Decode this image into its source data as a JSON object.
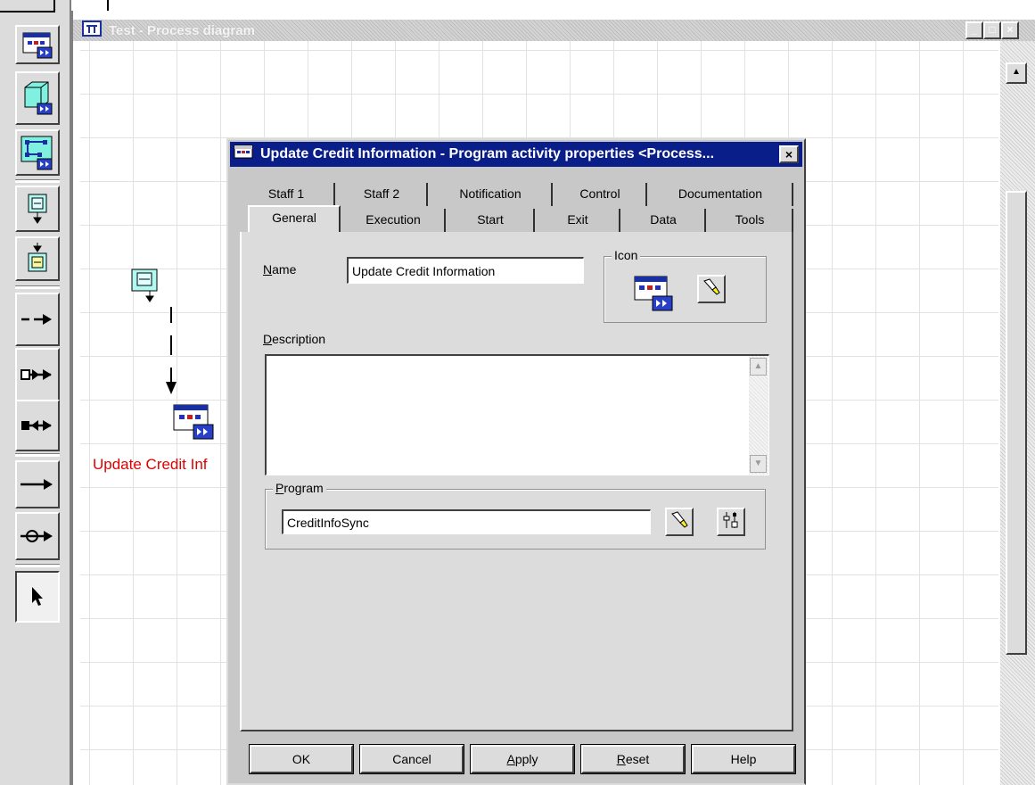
{
  "mdi_window": {
    "title": "Test - Process diagram",
    "minimize_glyph": "_",
    "restore_glyph": "□",
    "close_glyph": "×",
    "scroll_up_glyph": "▲"
  },
  "toolbar": {
    "tools": [
      {
        "icon": "program-activity-icon"
      },
      {
        "icon": "process-activity-icon"
      },
      {
        "icon": "block-activity-icon"
      },
      {
        "icon": "source-node-icon"
      },
      {
        "icon": "sink-node-icon"
      },
      {
        "icon": "control-connector-icon"
      },
      {
        "icon": "data-connector-icon"
      },
      {
        "icon": "data-connector-reverse-icon"
      },
      {
        "icon": "default-connector-icon"
      },
      {
        "icon": "loop-connector-icon"
      },
      {
        "icon": "select-pointer-icon"
      }
    ]
  },
  "diagram": {
    "node_label": "Update Credit Inf"
  },
  "dialog": {
    "title": "Update Credit Information - Program activity properties <Process...",
    "close_glyph": "×",
    "tabs_back": [
      "Staff 1",
      "Staff 2",
      "Notification",
      "Control",
      "Documentation"
    ],
    "tabs_front": [
      "General",
      "Execution",
      "Start",
      "Exit",
      "Data",
      "Tools"
    ],
    "active_tab": "General",
    "name_label_first": "N",
    "name_label_rest": "ame",
    "name_value": "Update Credit Information",
    "icon_group_label": "Icon",
    "description_label_first": "D",
    "description_label_rest": "escription",
    "description_value": "",
    "program_group_first": "P",
    "program_group_rest": "rogram",
    "program_value": "CreditInfoSync",
    "buttons": {
      "ok": "OK",
      "cancel": "Cancel",
      "apply_first": "A",
      "apply_rest": "pply",
      "reset_first": "R",
      "reset_rest": "eset",
      "help": "Help"
    },
    "colors": {
      "title_bar": "#0a1e8a",
      "label_red": "#e00000"
    }
  }
}
